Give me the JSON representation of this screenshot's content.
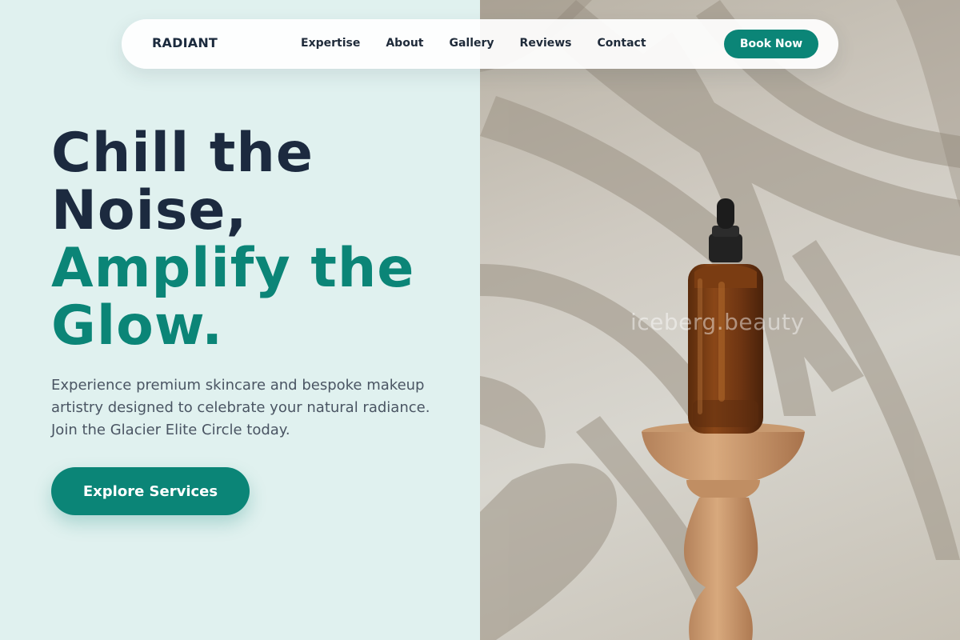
{
  "brand": {
    "name": "RADIANT"
  },
  "nav": {
    "links": [
      "Expertise",
      "About",
      "Gallery",
      "Reviews",
      "Contact"
    ],
    "cta_label": "Book Now"
  },
  "hero": {
    "headline_line1": "Chill the",
    "headline_line2": "Noise,",
    "headline_line3": "Amplify the",
    "headline_line4": "Glow.",
    "description": "Experience premium skincare and bespoke makeup artistry designed to celebrate your natural radiance. Join the Glacier Elite Circle today.",
    "cta_label": "Explore Services"
  },
  "image": {
    "watermark": "iceberg.beauty"
  },
  "colors": {
    "accent": "#0b8577",
    "dark_text": "#1c2a3f",
    "background": "#e0f1ef"
  }
}
